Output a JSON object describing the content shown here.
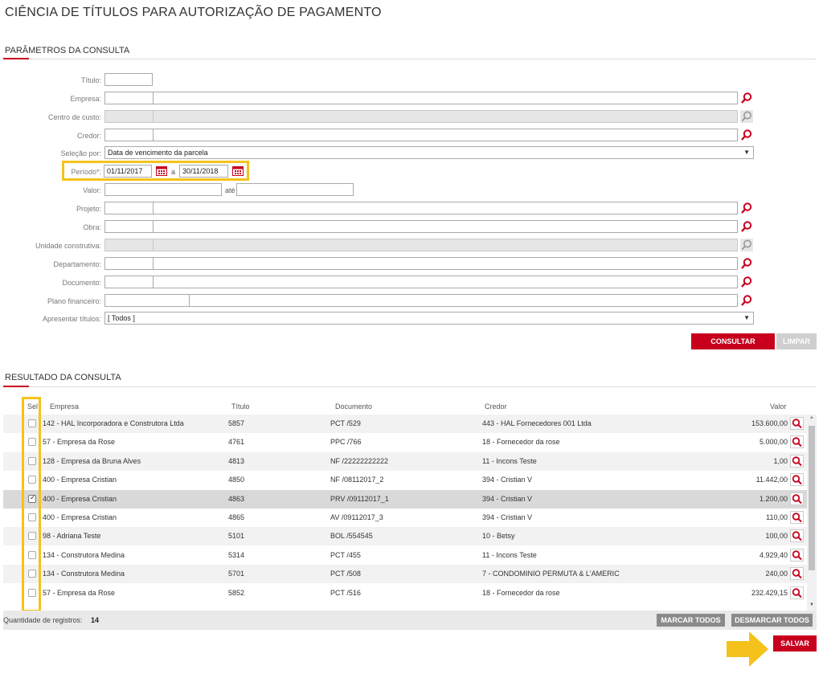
{
  "page_title": "CIÊNCIA DE TÍTULOS PARA AUTORIZAÇÃO DE PAGAMENTO",
  "params_section_title": "PARÂMETROS DA CONSULTA",
  "form": {
    "titulo_label": "Título:",
    "empresa_label": "Empresa:",
    "centro_label": "Centro de custo:",
    "credor_label": "Credor:",
    "selecao_label": "Seleção por:",
    "selecao_value": "Data de vencimento da parcela",
    "periodo_label": "Período*:",
    "periodo_inicio": "01/11/2017",
    "periodo_sep": "a",
    "periodo_fim": "30/11/2018",
    "valor_label": "Valor:",
    "valor_sep": "até",
    "projeto_label": "Projeto:",
    "obra_label": "Obra:",
    "unidade_label": "Unidade construtiva:",
    "departamento_label": "Departamento:",
    "documento_label": "Documento:",
    "plano_label": "Plano financeiro:",
    "apresentar_label": "Apresentar títulos:",
    "apresentar_value": "[ Todos ]"
  },
  "buttons": {
    "consultar": "CONSULTAR",
    "limpar": "LIMPAR",
    "marcar_todos": "MARCAR TODOS",
    "desmarcar_todos": "DESMARCAR TODOS",
    "salvar": "SALVAR"
  },
  "result_section_title": "RESULTADO DA CONSULTA",
  "table": {
    "headers": {
      "sel": "Sel",
      "empresa": "Empresa",
      "titulo": "Título",
      "documento": "Documento",
      "credor": "Credor",
      "valor": "Valor"
    },
    "rows": [
      {
        "checked": false,
        "empresa": "142 - HAL Incorporadora e Construtora Ltda",
        "titulo": "5857",
        "documento": "PCT /529",
        "credor": "443 - HAL Fornecedores 001 Ltda",
        "valor": "153.600,00"
      },
      {
        "checked": false,
        "empresa": "57 - Empresa da Rose",
        "titulo": "4761",
        "documento": "PPC /766",
        "credor": "18 - Fornecedor da rose",
        "valor": "5.000,00"
      },
      {
        "checked": false,
        "empresa": "128 - Empresa da Bruna Alves",
        "titulo": "4813",
        "documento": "NF /22222222222",
        "credor": "11 - Incons Teste",
        "valor": "1,00"
      },
      {
        "checked": false,
        "empresa": "400 - Empresa Cristian",
        "titulo": "4850",
        "documento": "NF /08112017_2",
        "credor": "394 - Cristian V",
        "valor": "11.442,00"
      },
      {
        "checked": true,
        "empresa": "400 - Empresa Cristian",
        "titulo": "4863",
        "documento": "PRV /09112017_1",
        "credor": "394 - Cristian V",
        "valor": "1.200,00"
      },
      {
        "checked": false,
        "empresa": "400 - Empresa Cristian",
        "titulo": "4865",
        "documento": "AV /09112017_3",
        "credor": "394 - Cristian V",
        "valor": "110,00"
      },
      {
        "checked": false,
        "empresa": "98 - Adriana Teste",
        "titulo": "5101",
        "documento": "BOL /554545",
        "credor": "10 - Betsy",
        "valor": "100,00"
      },
      {
        "checked": false,
        "empresa": "134 - Construtora Medina",
        "titulo": "5314",
        "documento": "PCT /455",
        "credor": "11 - Incons Teste",
        "valor": "4.929,40"
      },
      {
        "checked": false,
        "empresa": "134 - Construtora Medina",
        "titulo": "5701",
        "documento": "PCT /508",
        "credor": "7 - CONDOMINIO PERMUTA & L'AMERIC",
        "valor": "240,00"
      },
      {
        "checked": false,
        "empresa": "57 - Empresa da Rose",
        "titulo": "5852",
        "documento": "PCT /516",
        "credor": "18 - Fornecedor da rose",
        "valor": "232.429,15"
      }
    ]
  },
  "footer": {
    "count_label": "Quantidade de registros:",
    "count_value": "14"
  },
  "colors": {
    "accent": "#c8001e",
    "highlight": "#f5c21b"
  },
  "icons": {
    "search": "search-icon",
    "calendar": "calendar-icon",
    "arrow": "arrow-right-icon",
    "dropdown": "caret-down-icon"
  }
}
